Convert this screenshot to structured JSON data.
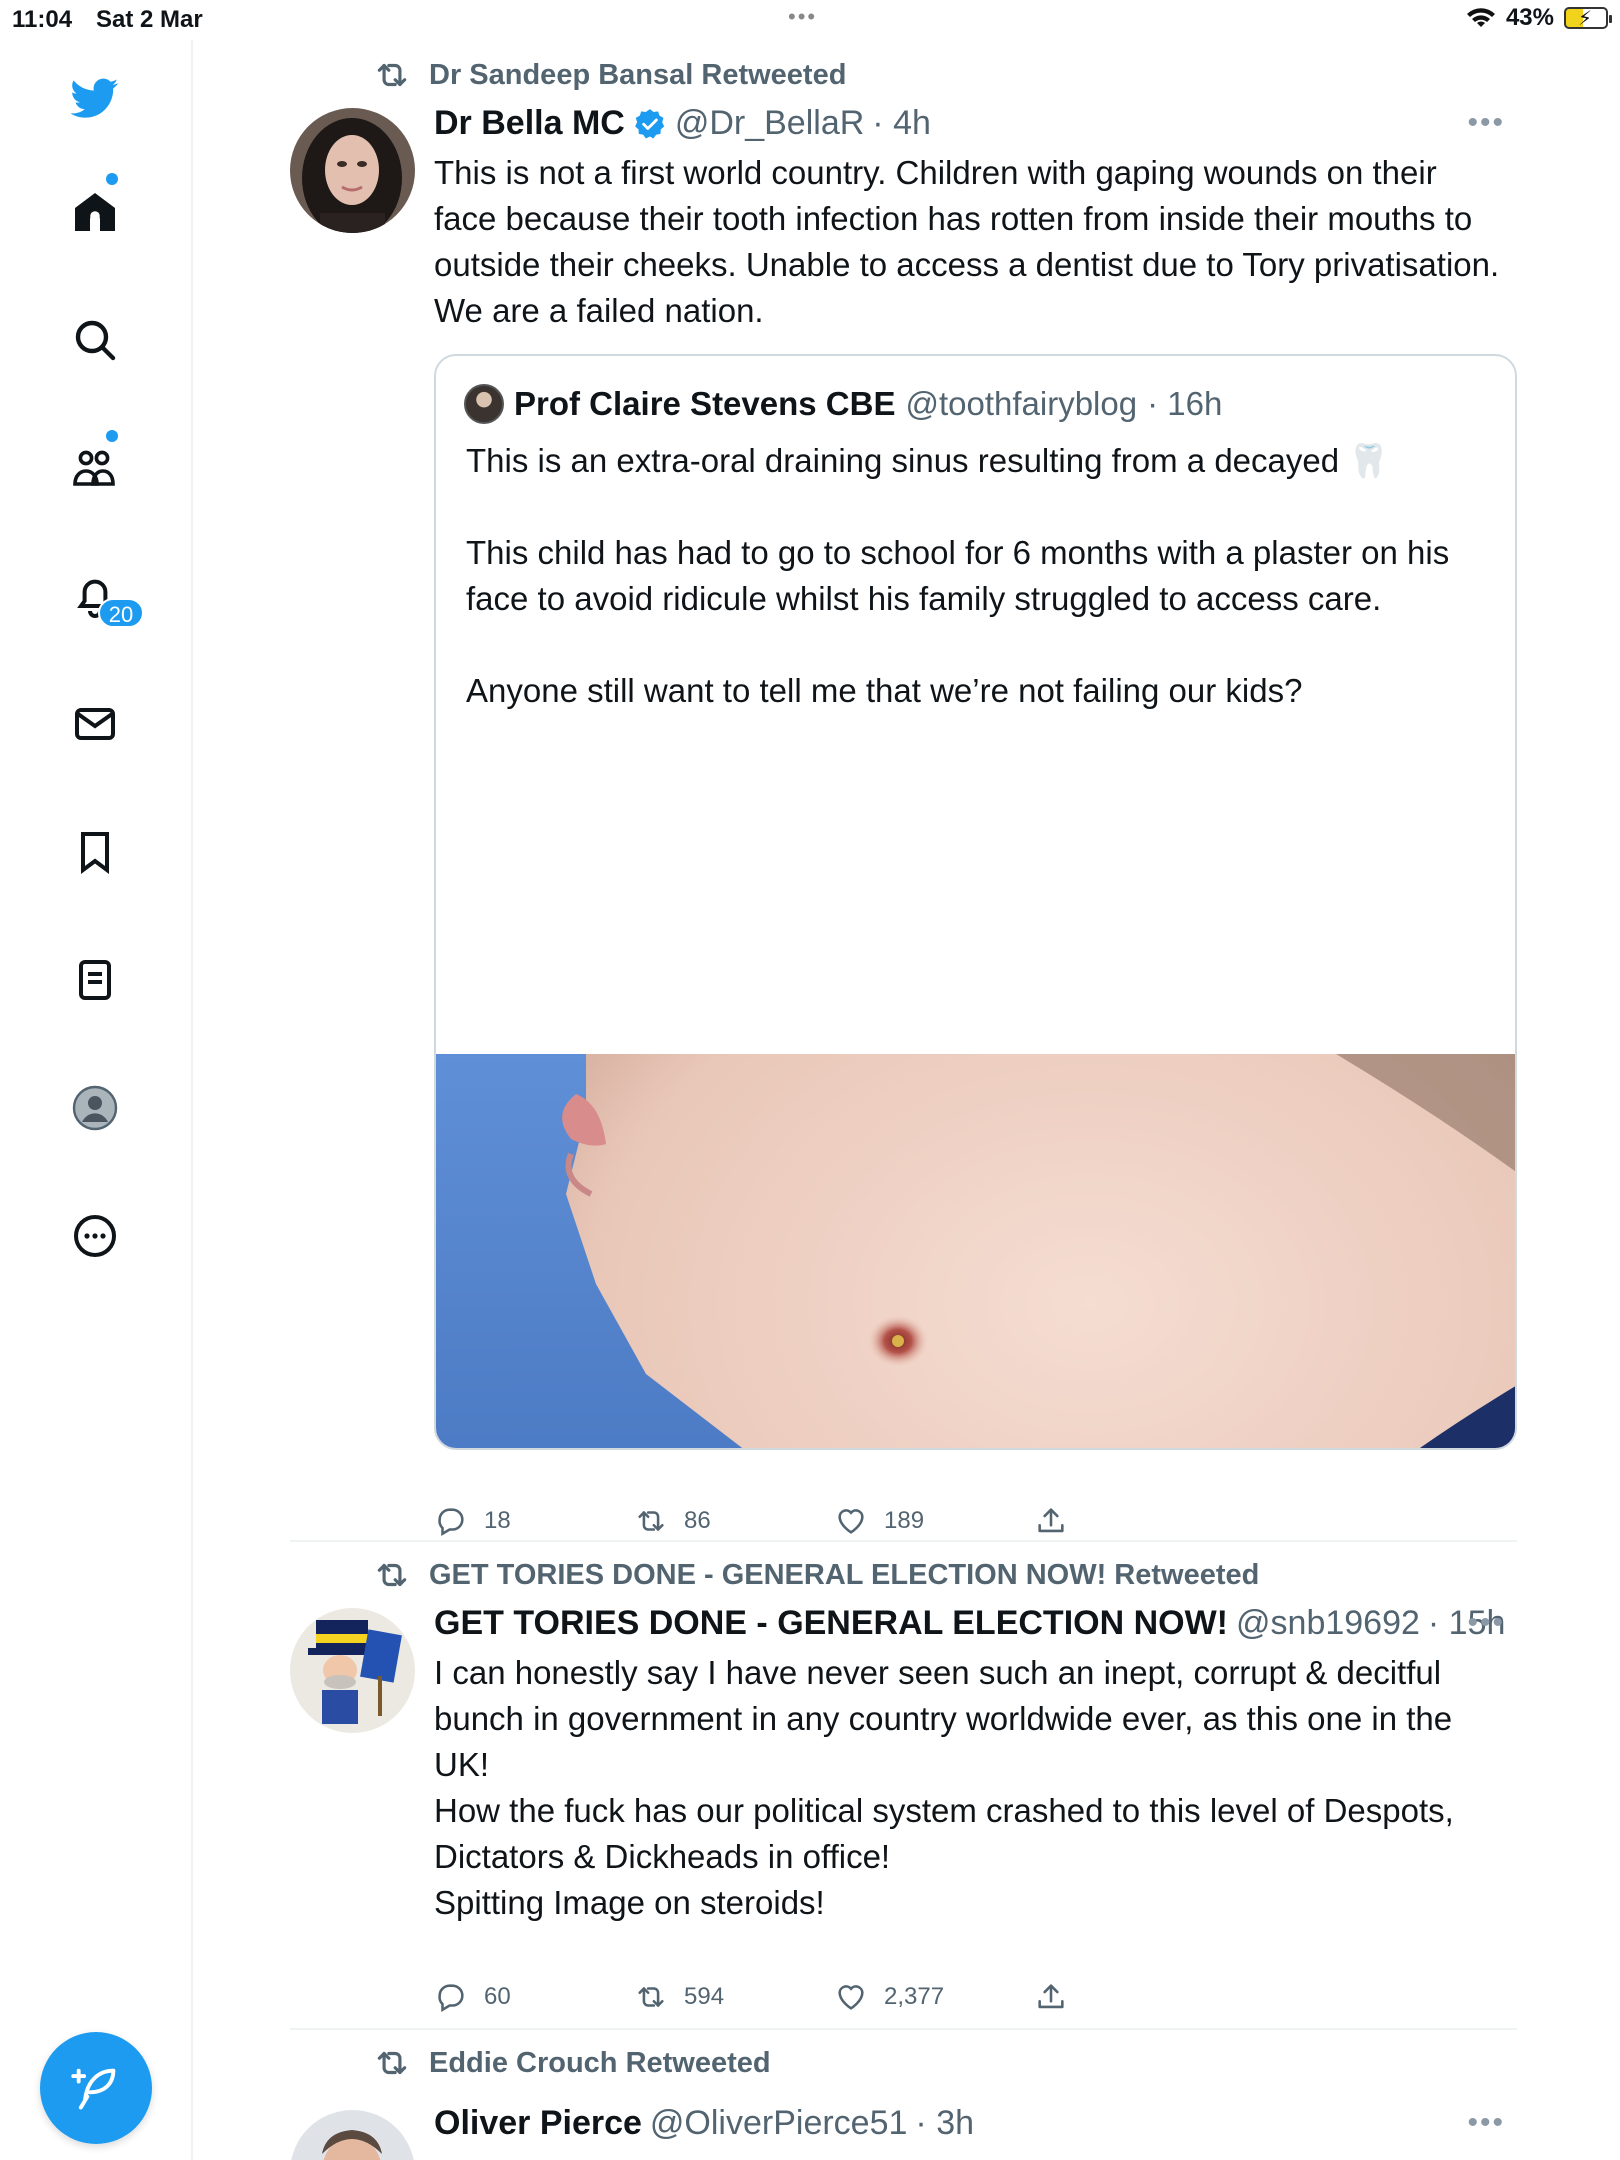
{
  "status_bar": {
    "time": "11:04",
    "date": "Sat 2 Mar",
    "battery": "43%"
  },
  "sidebar": {
    "items": [
      {
        "icon": "twitter-bird-icon"
      },
      {
        "icon": "home-icon"
      },
      {
        "icon": "search-icon"
      },
      {
        "icon": "communities-icon"
      },
      {
        "icon": "notifications-icon",
        "badge": "20"
      },
      {
        "icon": "messages-icon"
      },
      {
        "icon": "bookmarks-icon"
      },
      {
        "icon": "lists-icon"
      },
      {
        "icon": "profile-icon"
      },
      {
        "icon": "more-icon"
      }
    ],
    "compose_icon": "compose-icon"
  },
  "tweets": [
    {
      "retweeted_by": "Dr Sandeep Bansal Retweeted",
      "name": "Dr Bella MC",
      "verified": true,
      "handle": "@Dr_BellaR",
      "time": "· 4h",
      "text": "This is not a first world country. Children with gaping wounds on their face because their tooth infection has rotten from inside their mouths to outside their cheeks. Unable to access a dentist due to Tory privatisation. We are a failed nation.",
      "quote": {
        "name": "Prof Claire Stevens CBE",
        "handle": "@toothfairyblog",
        "time": "· 16h",
        "text": "This is an extra-oral draining sinus resulting from a decayed 🦷\n\nThis child has had to go to school for 6 months with a plaster on his face to avoid ridicule whilst his family struggled to access care.\n\nAnyone still want to tell me that we’re not failing our kids?"
      },
      "replies": "18",
      "retweets": "86",
      "likes": "189"
    },
    {
      "retweeted_by": "GET TORIES DONE - GENERAL ELECTION NOW! Retweeted",
      "name": "GET TORIES DONE - GENERAL ELECTION NOW!",
      "handle": "@snb19692",
      "time": "· 15h",
      "text": "I can honestly say I have never seen such an inept, corrupt & decitful bunch in government in any country worldwide ever, as this one in the UK!\nHow the fuck has our political system crashed to this level of Despots, Dictators & Dickheads in office!\nSpitting Image on steroids!",
      "replies": "60",
      "retweets": "594",
      "likes": "2,377"
    },
    {
      "retweeted_by": "Eddie Crouch Retweeted",
      "name": "Oliver Pierce",
      "handle": "@OliverPierce51",
      "time": "· 3h"
    }
  ],
  "colors": {
    "accent": "#1d9bf0",
    "text": "#0f1419",
    "secondary": "#536471",
    "border": "#cfd9de"
  }
}
